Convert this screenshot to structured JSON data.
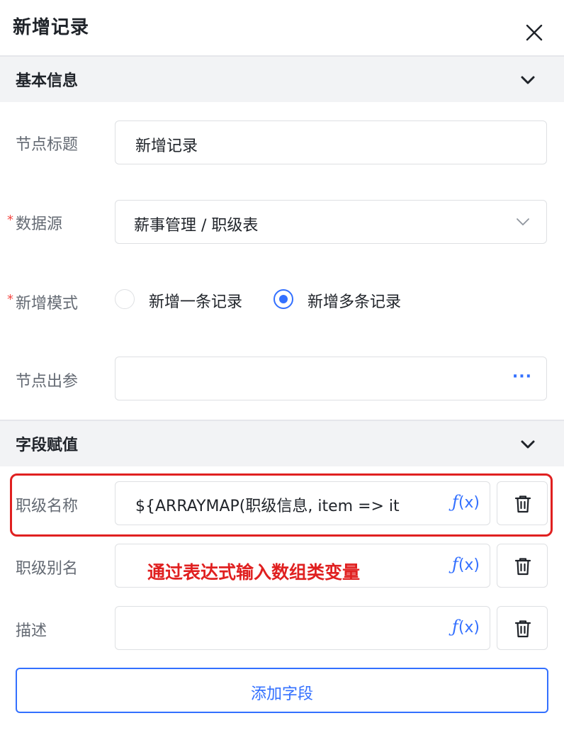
{
  "header": {
    "title": "新增记录",
    "close_icon": "close-icon"
  },
  "basic_section": {
    "title": "基本信息",
    "expanded": true
  },
  "form": {
    "node_title": {
      "label": "节点标题",
      "value": "新增记录"
    },
    "data_source": {
      "label": "数据源",
      "required_mark": "*",
      "value": "薪事管理 / 职级表"
    },
    "add_mode": {
      "label": "新增模式",
      "required_mark": "*",
      "options": [
        {
          "label": "新增一条记录",
          "checked": false
        },
        {
          "label": "新增多条记录",
          "checked": true
        }
      ]
    },
    "node_output": {
      "label": "节点出参",
      "value": "",
      "more_label": "···"
    }
  },
  "field_section": {
    "title": "字段赋值",
    "expanded": true,
    "fields": [
      {
        "label": "职级名称",
        "value": "${ARRAYMAP(职级信息, item => it",
        "fx_label": "(x)"
      },
      {
        "label": "职级别名",
        "value": "",
        "fx_label": "(x)"
      },
      {
        "label": "描述",
        "value": "",
        "fx_label": "(x)"
      }
    ],
    "add_button_label": "添加字段"
  },
  "annotation": {
    "text": "通过表达式输入数组类变量",
    "color": "#e02020"
  },
  "colors": {
    "accent": "#3370ff",
    "required": "#f54a45",
    "section_bg": "#f2f3f5",
    "border": "#dee0e3"
  }
}
